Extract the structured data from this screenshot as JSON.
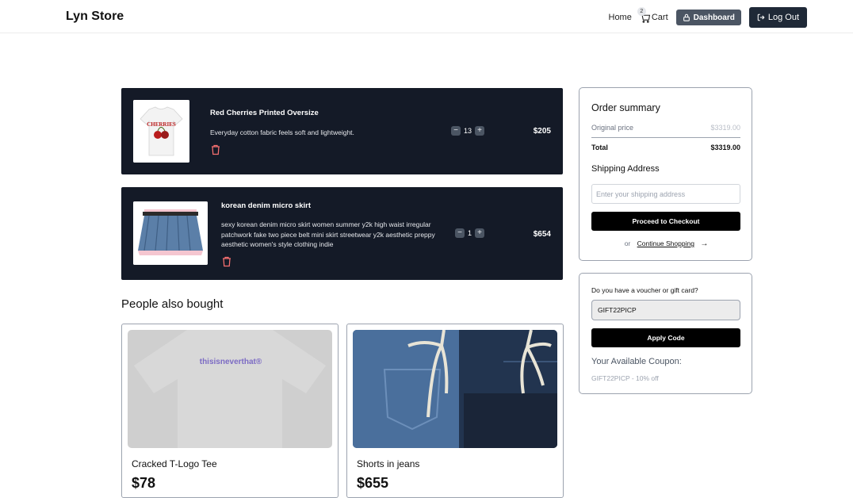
{
  "navbar": {
    "brand": "Lyn Store",
    "home_label": "Home",
    "cart_label": "Cart",
    "cart_count": "2",
    "dashboard_label": "Dashboard",
    "logout_label": "Log Out"
  },
  "cart": {
    "items": [
      {
        "name": "Red Cherries Printed Oversize",
        "description": "Everyday cotton fabric feels soft and lightweight.",
        "quantity": "13",
        "price": "$205"
      },
      {
        "name": "korean denim micro skirt",
        "description": "sexy korean denim micro skirt women summer y2k high waist irregular patchwork fake two piece belt mini skirt streetwear y2k aesthetic preppy aesthetic women's style clothing indie",
        "quantity": "1",
        "price": "$654"
      }
    ]
  },
  "also_bought": {
    "title": "People also bought",
    "products": [
      {
        "name": "Cracked T-Logo Tee",
        "price": "$78",
        "image_text": "thisisneverthat®"
      },
      {
        "name": "Shorts in jeans",
        "price": "$655"
      }
    ]
  },
  "summary": {
    "title": "Order summary",
    "original_label": "Original price",
    "original_value": "$3319.00",
    "total_label": "Total",
    "total_value": "$3319.00",
    "shipping_label": "Shipping Address",
    "shipping_placeholder": "Enter your shipping address",
    "checkout_label": "Proceed to Checkout",
    "or_text": "or",
    "continue_label": "Continue Shopping"
  },
  "voucher": {
    "label": "Do you have a voucher or gift card?",
    "code_value": "GIFT22PICP",
    "apply_label": "Apply Code",
    "available_title": "Your Available Coupon:",
    "available_text": "GIFT22PICP - 10% off"
  },
  "colors": {
    "card_bg": "#141a27",
    "trash": "#f87171",
    "dashboard_bg": "#4b5563",
    "logout_bg": "#1f2937"
  }
}
